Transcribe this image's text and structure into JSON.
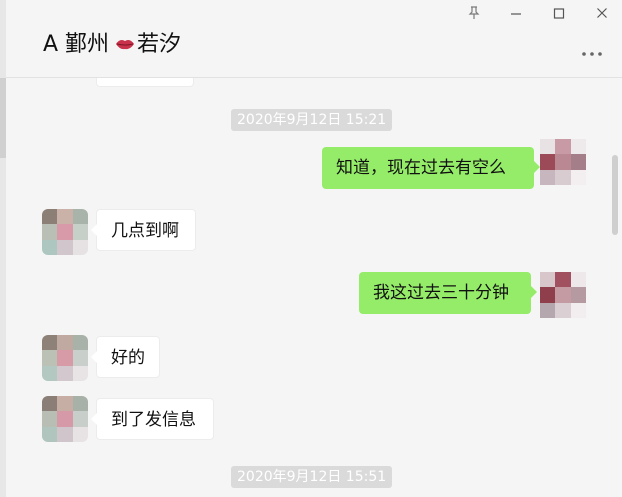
{
  "header": {
    "title_prefix": "A 鄞州",
    "title_suffix": "若汐",
    "title_emoji_icon": "lips-icon"
  },
  "window_controls": {
    "pin_icon": "pin-icon",
    "minimize_icon": "minimize-icon",
    "maximize_icon": "maximize-icon",
    "close_icon": "close-icon"
  },
  "more_icon": "more-dots-icon",
  "colors": {
    "outgoing_bubble": "#95ec69",
    "incoming_bubble": "#ffffff",
    "timestamp_bg": "#dadada",
    "background": "#f5f5f5"
  },
  "messages": {
    "ts1": "2020年9月12日 15:21",
    "m1": "知道，现在过去有空么",
    "m2": "几点到啊",
    "m3": "我这过去三十分钟",
    "m4": "好的",
    "m5": "到了发信息",
    "ts2": "2020年9月12日 15:51"
  }
}
